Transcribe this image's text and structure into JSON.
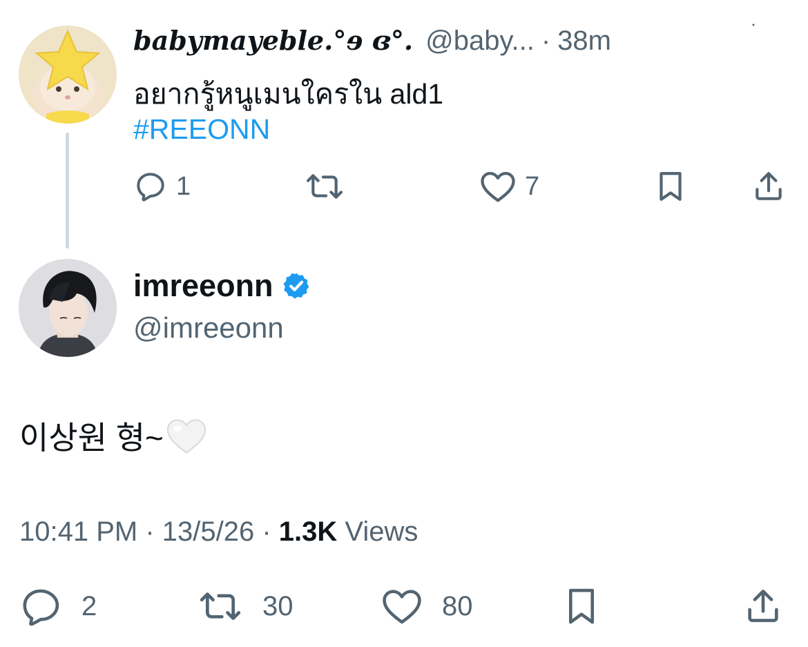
{
  "parent_tweet": {
    "display_name": "babymayeble.°ɘ ɞ°.",
    "handle": "@baby...",
    "separator": "·",
    "time": "38m",
    "text": "อยากรู้หนูเมนใครใน ald1",
    "hashtag": "#REEONN",
    "actions": {
      "reply_icon": "reply-icon",
      "reply_count": "1",
      "retweet_icon": "retweet-icon",
      "like_icon": "heart-icon",
      "like_count": "7",
      "bookmark_icon": "bookmark-icon",
      "share_icon": "share-icon"
    }
  },
  "main_tweet": {
    "display_name": "imreeonn",
    "verified_icon": "verified-badge-icon",
    "handle": "@imreeonn",
    "text": "이상원 형~",
    "emoji": "white-heart",
    "time": "10:41 PM",
    "sep1": " · ",
    "date": "13/5/26",
    "sep2": " · ",
    "views_count": "1.3K",
    "views_label": " Views",
    "actions": {
      "reply_icon": "reply-icon",
      "reply_count": "2",
      "retweet_icon": "retweet-icon",
      "retweet_count": "30",
      "like_icon": "heart-icon",
      "like_count": "80",
      "bookmark_icon": "bookmark-icon",
      "share_icon": "share-icon"
    }
  },
  "colors": {
    "text_primary": "#0f1419",
    "text_secondary": "#536471",
    "link": "#1d9bf0",
    "thread_line": "#cfd9de",
    "verified": "#1d9bf0"
  }
}
